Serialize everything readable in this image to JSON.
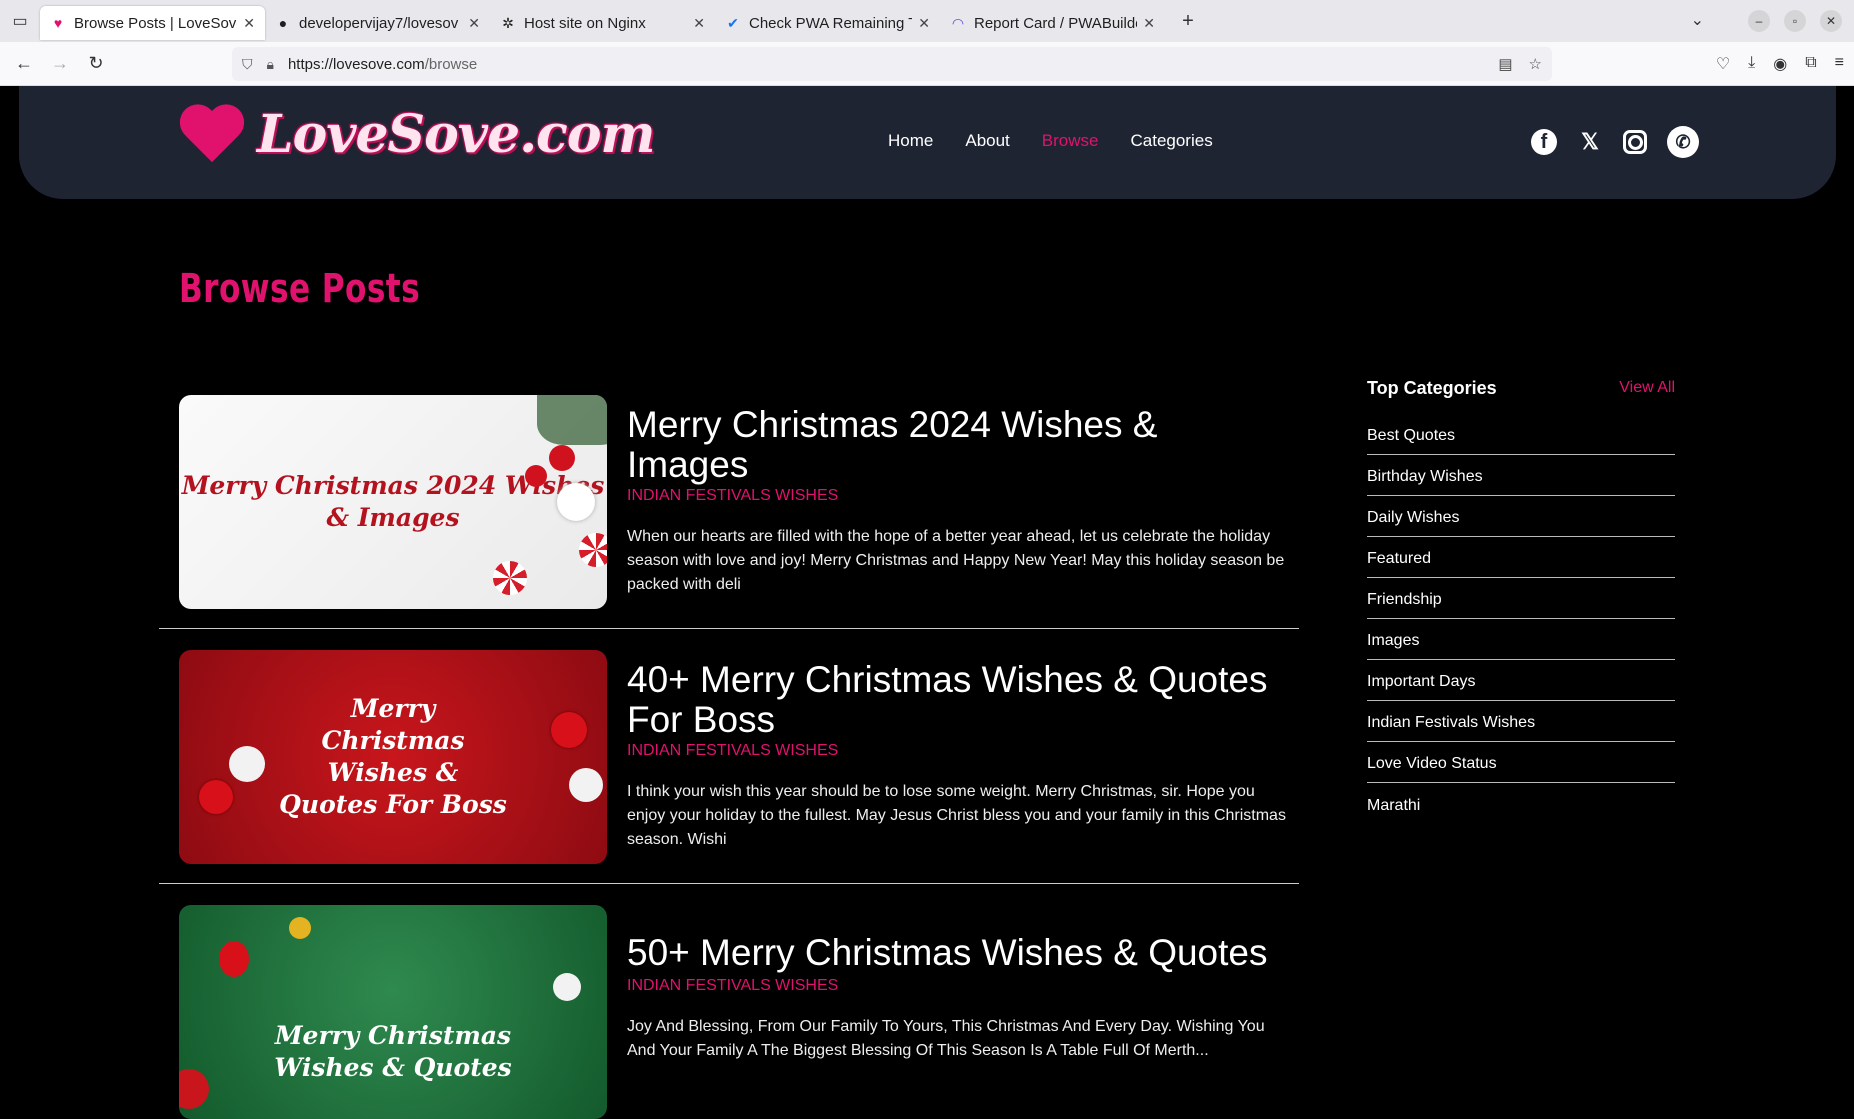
{
  "browser": {
    "tabs": [
      {
        "title": "Browse Posts | LoveSove",
        "icon": "heart-icon",
        "active": true
      },
      {
        "title": "developervijay7/lovesov",
        "icon": "github-icon",
        "active": false
      },
      {
        "title": "Host site on Nginx",
        "icon": "openai-icon",
        "active": false
      },
      {
        "title": "Check PWA Remaining T",
        "icon": "check-icon",
        "active": false
      },
      {
        "title": "Report Card / PWABuilde",
        "icon": "pwabuilder-icon",
        "active": false
      }
    ],
    "url_host": "https://lovesove.com",
    "url_path": "/browse"
  },
  "site": {
    "logo_text": "LoveSove.com",
    "nav": [
      {
        "label": "Home",
        "active": false
      },
      {
        "label": "About",
        "active": false
      },
      {
        "label": "Browse",
        "active": true
      },
      {
        "label": "Categories",
        "active": false
      }
    ],
    "social": [
      "facebook-icon",
      "x-icon",
      "instagram-icon",
      "whatsapp-icon"
    ],
    "accent_color": "#e0126e",
    "header_bg": "#1e2432"
  },
  "page": {
    "title": "Browse Posts"
  },
  "posts": [
    {
      "title": "Merry Christmas 2024 Wishes & Images",
      "category": "INDIAN FESTIVALS WISHES",
      "excerpt": "When our hearts are filled with the hope of a better year ahead, let us celebrate the holiday season with love and joy! Merry Christmas and Happy New Year! May this holiday season be packed with deli",
      "thumb_text": "Merry Christmas 2024 Wishes & Images"
    },
    {
      "title": "40+ Merry Christmas Wishes & Quotes For Boss",
      "category": "INDIAN FESTIVALS WISHES",
      "excerpt": "I think your wish this year should be to lose some weight. Merry Christmas, sir. Hope you enjoy your holiday to the fullest. May Jesus Christ bless you and your family in this Christmas season. Wishi",
      "thumb_text": "Merry Christmas Wishes & Quotes For Boss"
    },
    {
      "title": "50+ Merry Christmas Wishes & Quotes",
      "category": "INDIAN FESTIVALS WISHES",
      "excerpt": "Joy And Blessing, From Our Family To Yours, This Christmas And Every Day. Wishing You And Your Family A The Biggest Blessing Of This Season Is A Table Full Of Merth...",
      "thumb_text": "Merry Christmas Wishes & Quotes"
    }
  ],
  "sidebar": {
    "title": "Top Categories",
    "view_all": "View All",
    "categories": [
      "Best Quotes",
      "Birthday Wishes",
      "Daily Wishes",
      "Featured",
      "Friendship",
      "Images",
      "Important Days",
      "Indian Festivals Wishes",
      "Love Video Status",
      "Marathi"
    ]
  }
}
